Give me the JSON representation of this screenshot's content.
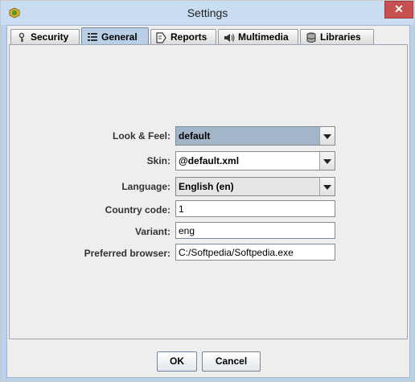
{
  "window": {
    "title": "Settings",
    "close_glyph": "✕"
  },
  "tabs": [
    {
      "label": "Security",
      "icon": "key-icon"
    },
    {
      "label": "General",
      "icon": "settings-list-icon"
    },
    {
      "label": "Reports",
      "icon": "report-icon"
    },
    {
      "label": "Multimedia",
      "icon": "speaker-icon"
    },
    {
      "label": "Libraries",
      "icon": "database-icon"
    }
  ],
  "active_tab": "General",
  "form": {
    "look_and_feel": {
      "label": "Look & Feel:",
      "value": "default"
    },
    "skin": {
      "label": "Skin:",
      "value": "@default.xml"
    },
    "language": {
      "label": "Language:",
      "value": "English (en)"
    },
    "country_code": {
      "label": "Country code:",
      "value": "1"
    },
    "variant": {
      "label": "Variant:",
      "value": "eng"
    },
    "preferred_browser": {
      "label": "Preferred browser:",
      "value": "C:/Softpedia/Softpedia.exe"
    }
  },
  "buttons": {
    "ok": "OK",
    "cancel": "Cancel"
  }
}
